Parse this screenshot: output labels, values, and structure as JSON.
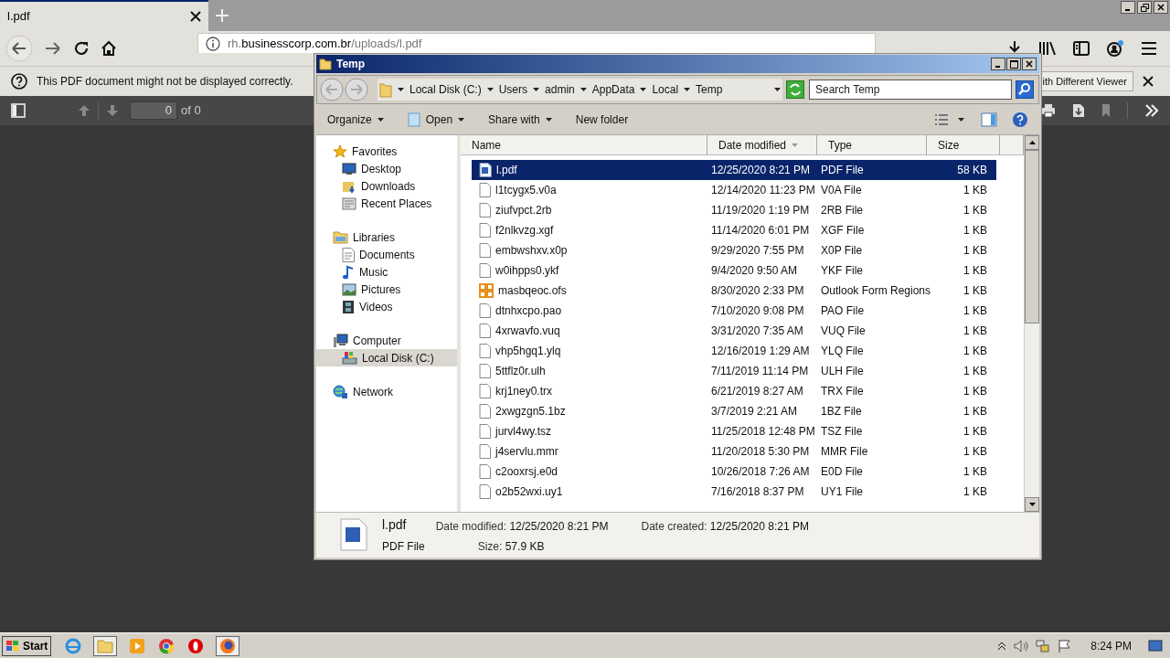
{
  "browser": {
    "tab": {
      "title": "l.pdf"
    },
    "url_host_prefix": "rh.",
    "url_domain": "businesscorp.com.br",
    "url_path": "/uploads/l.pdf",
    "notice": "This PDF document might not be displayed correctly.",
    "viewer_button": "ith Different Viewer",
    "page_number": "0",
    "page_count": "of 0"
  },
  "explorer": {
    "title": "Temp",
    "breadcrumbs": [
      "Local Disk (C:)",
      "Users",
      "admin",
      "AppData",
      "Local",
      "Temp"
    ],
    "search": {
      "placeholder": "Search Temp"
    },
    "toolbar": [
      {
        "label": "Organize",
        "dropdown": true,
        "kind": "plain"
      },
      {
        "label": "Open",
        "dropdown": true,
        "kind": "open"
      },
      {
        "label": "Share with",
        "dropdown": true,
        "kind": "plain"
      },
      {
        "label": "New folder",
        "dropdown": false,
        "kind": "plain"
      }
    ],
    "nav": [
      {
        "label": "Favorites",
        "kind": "star",
        "selected": false,
        "children": [
          {
            "label": "Desktop",
            "kind": "desktop",
            "selected": false
          },
          {
            "label": "Downloads",
            "kind": "downloads",
            "selected": false
          },
          {
            "label": "Recent Places",
            "kind": "recent",
            "selected": false
          }
        ]
      },
      {
        "label": "Libraries",
        "kind": "libraries",
        "selected": false,
        "children": [
          {
            "label": "Documents",
            "kind": "documents",
            "selected": false
          },
          {
            "label": "Music",
            "kind": "music",
            "selected": false
          },
          {
            "label": "Pictures",
            "kind": "pictures",
            "selected": false
          },
          {
            "label": "Videos",
            "kind": "videos",
            "selected": false
          }
        ]
      },
      {
        "label": "Computer",
        "kind": "computer",
        "selected": false,
        "children": [
          {
            "label": "Local Disk (C:)",
            "kind": "disk",
            "selected": true
          }
        ]
      },
      {
        "label": "Network",
        "kind": "network",
        "selected": false
      }
    ],
    "columns": [
      {
        "label": "Name",
        "sorted": false
      },
      {
        "label": "Date modified",
        "sorted": true
      },
      {
        "label": "Type",
        "sorted": false
      },
      {
        "label": "Size",
        "sorted": false
      }
    ],
    "files": [
      {
        "name": "l.pdf",
        "date": "12/25/2020 8:21 PM",
        "type": "PDF File",
        "size": "58 KB",
        "kind": "word",
        "selected": true
      },
      {
        "name": "l1tcygx5.v0a",
        "date": "12/14/2020 11:23 PM",
        "type": "V0A File",
        "size": "1 KB",
        "kind": "blank",
        "selected": false
      },
      {
        "name": "ziufvpct.2rb",
        "date": "11/19/2020 1:19 PM",
        "type": "2RB File",
        "size": "1 KB",
        "kind": "blank",
        "selected": false
      },
      {
        "name": "f2nlkvzg.xgf",
        "date": "11/14/2020 6:01 PM",
        "type": "XGF File",
        "size": "1 KB",
        "kind": "blank",
        "selected": false
      },
      {
        "name": "embwshxv.x0p",
        "date": "9/29/2020 7:55 PM",
        "type": "X0P File",
        "size": "1 KB",
        "kind": "blank",
        "selected": false
      },
      {
        "name": "w0ihpps0.ykf",
        "date": "9/4/2020 9:50 AM",
        "type": "YKF File",
        "size": "1 KB",
        "kind": "blank",
        "selected": false
      },
      {
        "name": "masbqeoc.ofs",
        "date": "8/30/2020 2:33 PM",
        "type": "Outlook Form Regions",
        "size": "1 KB",
        "kind": "outlook",
        "selected": false
      },
      {
        "name": "dtnhxcpo.pao",
        "date": "7/10/2020 9:08 PM",
        "type": "PAO File",
        "size": "1 KB",
        "kind": "blank",
        "selected": false
      },
      {
        "name": "4xrwavfo.vuq",
        "date": "3/31/2020 7:35 AM",
        "type": "VUQ File",
        "size": "1 KB",
        "kind": "blank",
        "selected": false
      },
      {
        "name": "vhp5hgq1.ylq",
        "date": "12/16/2019 1:29 AM",
        "type": "YLQ File",
        "size": "1 KB",
        "kind": "blank",
        "selected": false
      },
      {
        "name": "5ttflz0r.ulh",
        "date": "7/11/2019 11:14 PM",
        "type": "ULH File",
        "size": "1 KB",
        "kind": "blank",
        "selected": false
      },
      {
        "name": "krj1ney0.trx",
        "date": "6/21/2019 8:27 AM",
        "type": "TRX File",
        "size": "1 KB",
        "kind": "blank",
        "selected": false
      },
      {
        "name": "2xwgzgn5.1bz",
        "date": "3/7/2019 2:21 AM",
        "type": "1BZ File",
        "size": "1 KB",
        "kind": "blank",
        "selected": false
      },
      {
        "name": "jurvl4wy.tsz",
        "date": "11/25/2018 12:48 PM",
        "type": "TSZ File",
        "size": "1 KB",
        "kind": "blank",
        "selected": false
      },
      {
        "name": "j4servlu.mmr",
        "date": "11/20/2018 5:30 PM",
        "type": "MMR File",
        "size": "1 KB",
        "kind": "blank",
        "selected": false
      },
      {
        "name": "c2ooxrsj.e0d",
        "date": "10/26/2018 7:26 AM",
        "type": "E0D File",
        "size": "1 KB",
        "kind": "blank",
        "selected": false
      },
      {
        "name": "o2b52wxi.uy1",
        "date": "7/16/2018 8:37 PM",
        "type": "UY1 File",
        "size": "1 KB",
        "kind": "blank",
        "selected": false
      }
    ],
    "details": {
      "name": "l.pdf",
      "type": "PDF File",
      "modified_label": "Date modified:",
      "modified": "12/25/2020 8:21 PM",
      "created_label": "Date created:",
      "created": "12/25/2020 8:21 PM",
      "size_label": "Size:",
      "size": "57.9 KB"
    }
  },
  "taskbar": {
    "start": "Start",
    "clock": "8:24 PM"
  }
}
